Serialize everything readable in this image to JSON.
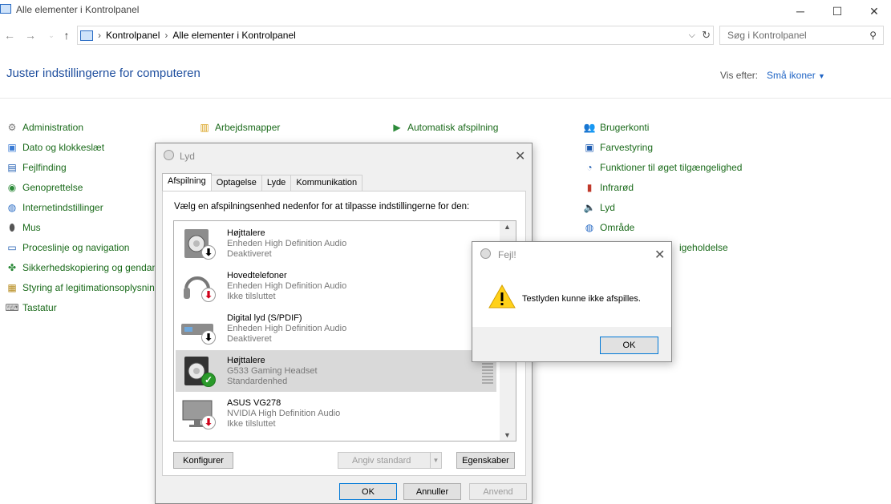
{
  "window": {
    "title": "Alle elementer i Kontrolpanel",
    "minimize": "─",
    "maximize": "☐",
    "close": "✕"
  },
  "address": {
    "crumbs": [
      "Kontrolpanel",
      "Alle elementer i Kontrolpanel"
    ],
    "search_placeholder": "Søg i Kontrolpanel"
  },
  "page": {
    "heading": "Juster indstillingerne for computeren",
    "view_by_label": "Vis efter:",
    "view_by_value": "Små ikoner"
  },
  "cp_items": {
    "col1": [
      "Administration",
      "Dato og klokkeslæt",
      "Fejlfinding",
      "Genoprettelse",
      "Internetindstillinger",
      "Mus",
      "Proceslinje og navigation",
      "Sikkerhedskopiering og gendan",
      "Styring af legitimationsoplysnin",
      "Tastatur"
    ],
    "col2": [
      "Arbejdsmapper"
    ],
    "col3": [
      "Automatisk afspilning"
    ],
    "col4": [
      "Brugerkonti",
      "Farvestyring",
      "Funktioner til øget tilgængelighed",
      "Infrarød",
      "Lyd",
      "Område"
    ],
    "col4_partial": "igeholdelse"
  },
  "sound_dialog": {
    "title": "Lyd",
    "tabs": [
      "Afspilning",
      "Optagelse",
      "Lyde",
      "Kommunikation"
    ],
    "instruction": "Vælg en afspilningsenhed nedenfor for at tilpasse indstillingerne for den:",
    "devices": [
      {
        "name": "Højttalere",
        "driver": "Enheden High Definition Audio",
        "status": "Deaktiveret",
        "badge": "down"
      },
      {
        "name": "Hovedtelefoner",
        "driver": "Enheden High Definition Audio",
        "status": "Ikke tilsluttet",
        "badge": "red"
      },
      {
        "name": "Digital lyd (S/PDIF)",
        "driver": "Enheden High Definition Audio",
        "status": "Deaktiveret",
        "badge": "down"
      },
      {
        "name": "Højttalere",
        "driver": "G533 Gaming Headset",
        "status": "Standardenhed",
        "badge": "check"
      },
      {
        "name": "ASUS VG278",
        "driver": "NVIDIA High Definition Audio",
        "status": "Ikke tilsluttet",
        "badge": "red"
      }
    ],
    "buttons": {
      "configure": "Konfigurer",
      "set_default": "Angiv standard",
      "properties": "Egenskaber",
      "ok": "OK",
      "cancel": "Annuller",
      "apply": "Anvend"
    }
  },
  "error_dialog": {
    "title": "Fejl!",
    "message": "Testlyden kunne ikke afspilles.",
    "ok": "OK"
  }
}
